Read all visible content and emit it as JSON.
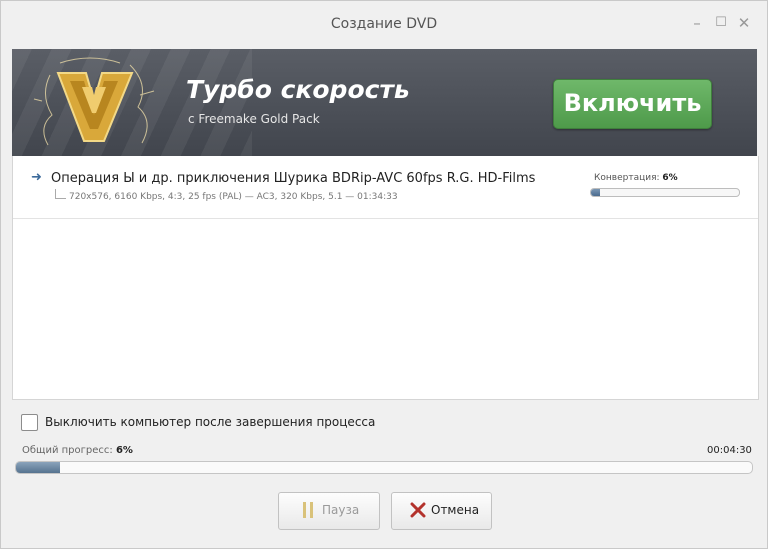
{
  "window": {
    "title": "Создание DVD",
    "minimize_glyph": "–",
    "maximize_glyph": "☐",
    "close_glyph": "✕"
  },
  "banner": {
    "title": "Турбо скорость",
    "subtitle": "с Freemake Gold Pack",
    "enable_label": "Включить",
    "logo_icon": "freemake-gold-logo-icon"
  },
  "file_list": {
    "items": [
      {
        "name": "Операция Ы и др. приключения Шурика BDRip-AVC 60fps R.G. HD-Films",
        "meta": "720x576, 6160 Kbps, 4:3, 25 fps (PAL) — AC3, 320 Kbps, 5.1 — 01:34:33",
        "status_label": "Конвертация:",
        "status_percent": "6%",
        "progress": 0.06
      }
    ]
  },
  "options": {
    "shutdown_label": "Выключить компьютер после завершения процесса",
    "shutdown_checked": false
  },
  "progress": {
    "overall_label": "Общий прогресс:",
    "overall_percent": "6%",
    "overall_fraction": 0.06,
    "time_remaining": "00:04:30"
  },
  "buttons": {
    "pause_label": "Пауза",
    "cancel_label": "Отмена"
  },
  "colors": {
    "enable_button": "#5aa756",
    "progress_fill": "#56738f",
    "cancel_icon": "#b3322c",
    "pause_icon": "#d9c27a"
  }
}
